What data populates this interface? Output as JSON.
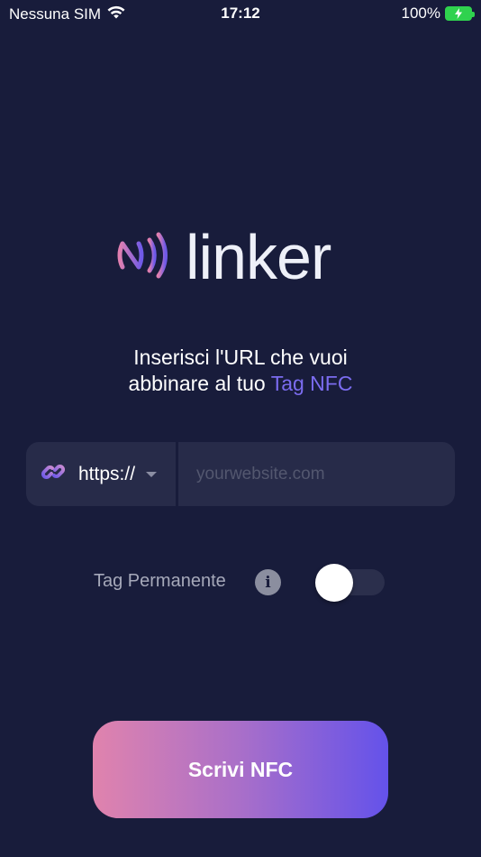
{
  "status_bar": {
    "carrier": "Nessuna SIM",
    "time": "17:12",
    "battery": "100%"
  },
  "logo": {
    "text": "linker",
    "icon": "nfc-waves-icon"
  },
  "prompt": {
    "line1": "Inserisci l'URL che vuoi",
    "line2_prefix": "abbinare al tuo ",
    "line2_accent": "Tag NFC"
  },
  "url_field": {
    "scheme": "https://",
    "placeholder": "yourwebsite.com",
    "value": ""
  },
  "permanent": {
    "label": "Tag Permanente",
    "info_glyph": "i",
    "enabled": false
  },
  "cta": {
    "label": "Scrivi NFC"
  },
  "colors": {
    "background": "#181c3b",
    "accent": "#7b6cf0",
    "field": "#272b49",
    "gradient_start": "#e083ad",
    "gradient_end": "#6452ea"
  }
}
